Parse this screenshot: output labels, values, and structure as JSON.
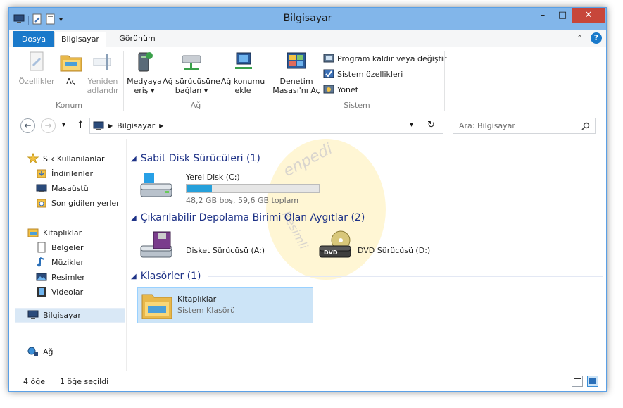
{
  "window": {
    "title": "Bilgisayar"
  },
  "titlebar": {
    "minimize": "–",
    "maximize": "□",
    "close": "✕"
  },
  "tabs": [
    {
      "label": "Dosya"
    },
    {
      "label": "Bilgisayar"
    },
    {
      "label": "Görünüm"
    }
  ],
  "ribbon": {
    "collapse": "^",
    "help": "?",
    "groups": {
      "konum": "Konum",
      "ag": "Ağ",
      "sistem": "Sistem"
    },
    "buttons": {
      "ozellikler": "Özellikler",
      "ac": "Aç",
      "yeniden_1": "Yeniden",
      "yeniden_2": "adlandır",
      "medya_1": "Medyaya",
      "medya_2": "eriş ▾",
      "surucu_1": "Ağ sürücüsüne",
      "surucu_2": "bağlan ▾",
      "konum_1": "Ağ konumu",
      "konum_2": "ekle",
      "denetim_1": "Denetim",
      "denetim_2": "Masası'nı Aç"
    },
    "system_items": [
      {
        "label": "Program kaldır veya değiştir"
      },
      {
        "label": "Sistem özellikleri"
      },
      {
        "label": "Yönet"
      }
    ]
  },
  "address": {
    "back": "←",
    "forward": "→",
    "recent": "▾",
    "up": "↑",
    "path": "Bilgisayar",
    "dropdown": "▾",
    "refresh": "↻",
    "search_placeholder": "Ara: Bilgisayar"
  },
  "navpane": {
    "favorites": "Sık Kullanılanlar",
    "fav_items": [
      "İndirilenler",
      "Masaüstü",
      "Son gidilen yerler"
    ],
    "libraries": "Kitaplıklar",
    "lib_items": [
      "Belgeler",
      "Müzikler",
      "Resimler",
      "Videolar"
    ],
    "computer": "Bilgisayar",
    "network": "Ağ"
  },
  "content": {
    "sections": [
      {
        "title": "Sabit Disk Sürücüleri (1)"
      },
      {
        "title": "Çıkarılabilir Depolama Birimi Olan Aygıtlar (2)"
      },
      {
        "title": "Klasörler (1)"
      }
    ],
    "local_disk": {
      "name": "Yerel Disk (C:)",
      "info": "48,2 GB boş, 59,6 GB toplam",
      "used_fraction": 0.19
    },
    "floppy": {
      "name": "Disket Sürücüsü (A:)"
    },
    "dvd": {
      "name": "DVD Sürücüsü (D:)",
      "badge": "DVD"
    },
    "folder": {
      "name": "Kitaplıklar",
      "sub": "Sistem Klasörü"
    }
  },
  "watermark": {
    "top": "enpedi",
    "bottom": "Resimli"
  },
  "status": {
    "count": "4 öğe",
    "selected": "1 öğe seçildi"
  },
  "colors": {
    "accent": "#1979ca",
    "titlebar": "#82b6ea",
    "close": "#c7463a",
    "section": "#1e3287",
    "diskbar": "#26a0da"
  }
}
